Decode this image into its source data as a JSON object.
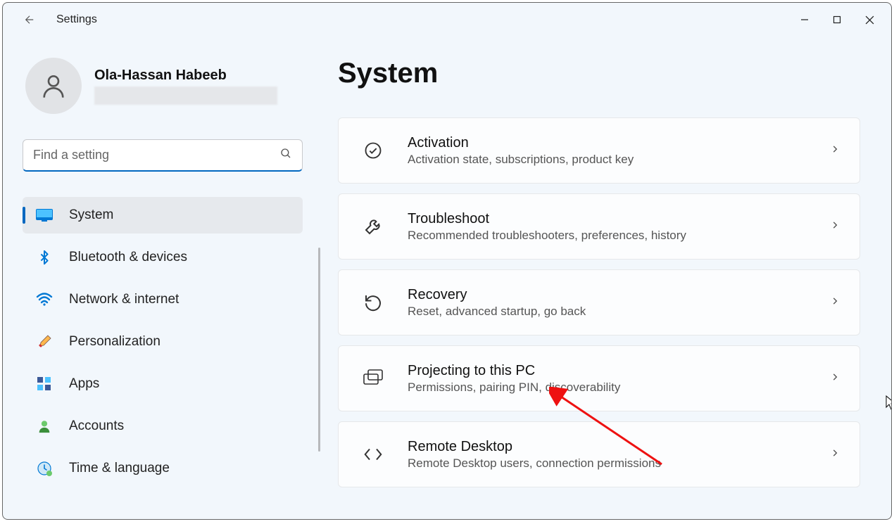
{
  "window": {
    "title": "Settings"
  },
  "profile": {
    "name": "Ola-Hassan Habeeb"
  },
  "search": {
    "placeholder": "Find a setting"
  },
  "nav": [
    {
      "id": "system",
      "label": "System",
      "icon": "monitor",
      "active": true
    },
    {
      "id": "bluetooth",
      "label": "Bluetooth & devices",
      "icon": "bluetooth",
      "active": false
    },
    {
      "id": "network",
      "label": "Network & internet",
      "icon": "wifi",
      "active": false
    },
    {
      "id": "personalization",
      "label": "Personalization",
      "icon": "brush",
      "active": false
    },
    {
      "id": "apps",
      "label": "Apps",
      "icon": "apps",
      "active": false
    },
    {
      "id": "accounts",
      "label": "Accounts",
      "icon": "person",
      "active": false
    },
    {
      "id": "time",
      "label": "Time & language",
      "icon": "clock",
      "active": false
    }
  ],
  "page": {
    "title": "System"
  },
  "cards": [
    {
      "id": "activation",
      "title": "Activation",
      "sub": "Activation state, subscriptions, product key",
      "icon": "check-circle"
    },
    {
      "id": "troubleshoot",
      "title": "Troubleshoot",
      "sub": "Recommended troubleshooters, preferences, history",
      "icon": "wrench"
    },
    {
      "id": "recovery",
      "title": "Recovery",
      "sub": "Reset, advanced startup, go back",
      "icon": "recovery"
    },
    {
      "id": "projecting",
      "title": "Projecting to this PC",
      "sub": "Permissions, pairing PIN, discoverability",
      "icon": "project"
    },
    {
      "id": "remote",
      "title": "Remote Desktop",
      "sub": "Remote Desktop users, connection permissions",
      "icon": "remote"
    }
  ]
}
